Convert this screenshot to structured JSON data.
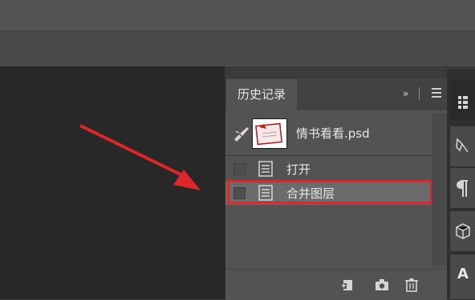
{
  "panel": {
    "tab_title": "历史记录",
    "collapse_glyph": "»",
    "snapshot_name": "情书看看.psd",
    "states": [
      {
        "label": "打开",
        "selected": false
      },
      {
        "label": "合并图层",
        "selected": true
      }
    ]
  },
  "right_dock": {
    "bottom_label": "A"
  },
  "colors": {
    "highlight": "#e0262a",
    "arrow": "#e0262a"
  },
  "icons": [
    "brush-icon",
    "document-icon",
    "new-document-from-state-icon",
    "camera-icon",
    "trash-icon"
  ]
}
